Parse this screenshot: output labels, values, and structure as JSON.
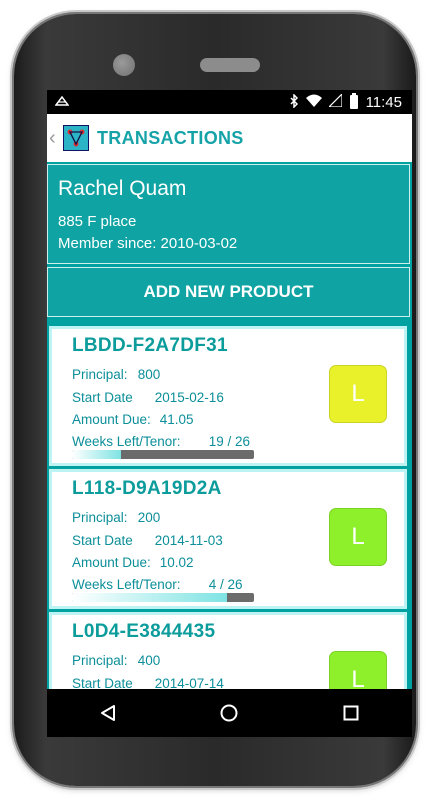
{
  "status_bar": {
    "time": "11:45",
    "icons": [
      "notification-icon",
      "bluetooth-icon",
      "wifi-icon",
      "signal-icon",
      "battery-icon"
    ]
  },
  "app_bar": {
    "back_icon": "back-chevron-icon",
    "logo_icon": "app-logo-icon",
    "title": "TRANSACTIONS"
  },
  "user": {
    "name": "Rachel Quam",
    "address": "885 F place",
    "member_since": "Member since: 2010-03-02"
  },
  "add_button": {
    "label": "ADD NEW PRODUCT"
  },
  "cards": [
    {
      "code": "LBDD-F2A7DF31",
      "principal_label": "Principal:",
      "principal_value": "800",
      "start_label": "Start Date",
      "start_value": "2015-02-16",
      "amount_label": "Amount Due:",
      "amount_value": "41.05",
      "weeks_label": "Weeks Left/Tenor:",
      "weeks_value": "19 / 26",
      "weeks_progress": 0.27,
      "badge": "L",
      "badge_color": "#e9f12a"
    },
    {
      "code": "L118-D9A19D2A",
      "principal_label": "Principal:",
      "principal_value": "200",
      "start_label": "Start Date",
      "start_value": "2014-11-03",
      "amount_label": "Amount Due:",
      "amount_value": "10.02",
      "weeks_label": "Weeks Left/Tenor:",
      "weeks_value": "4 / 26",
      "weeks_progress": 0.85,
      "badge": "L",
      "badge_color": "#8ef02a"
    },
    {
      "code": "L0D4-E3844435",
      "principal_label": "Principal:",
      "principal_value": "400",
      "start_label": "Start Date",
      "start_value": "2014-07-14",
      "badge": "L",
      "badge_color": "#8ef02a"
    }
  ],
  "nav_bar": {
    "back_icon": "nav-back-triangle-icon",
    "home_icon": "nav-home-circle-icon",
    "recents_icon": "nav-recents-square-icon"
  },
  "colors": {
    "teal": "#0fa3a3",
    "title_teal": "#16a3a8",
    "card_text": "#0d8f9a"
  }
}
